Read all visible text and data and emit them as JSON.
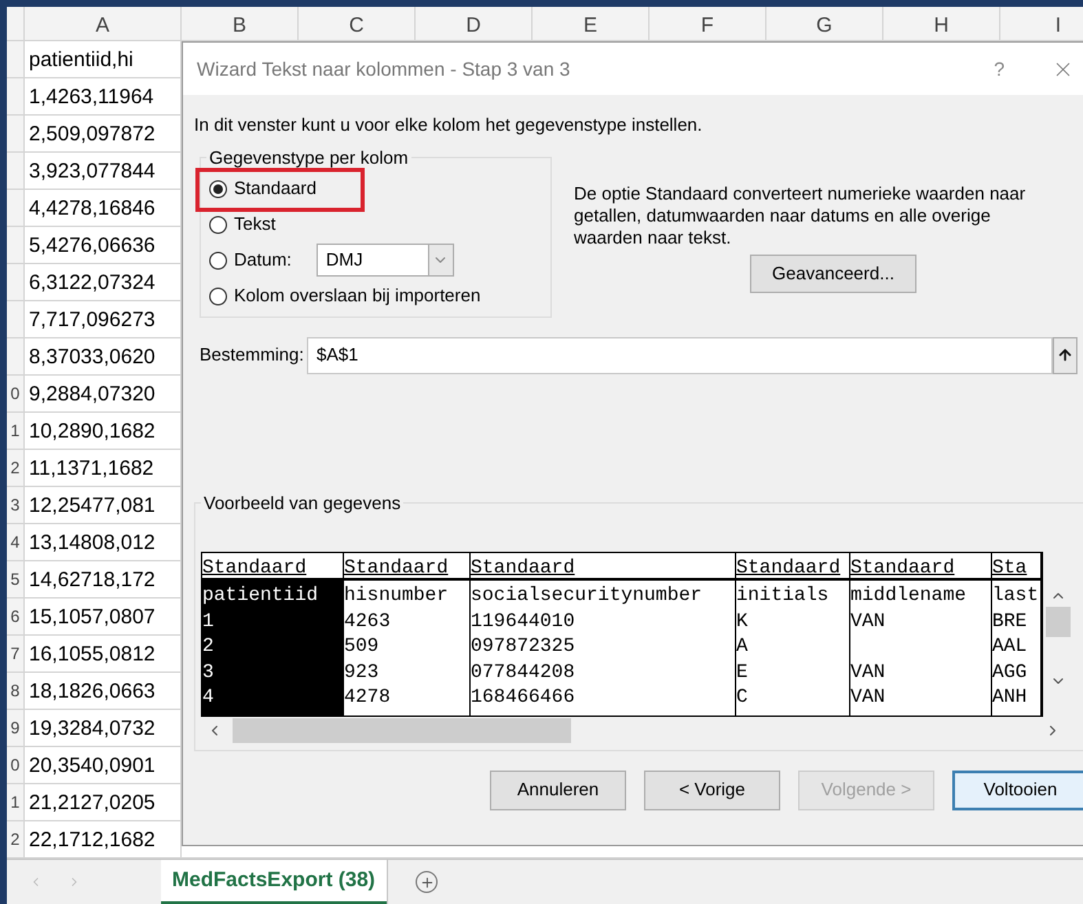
{
  "spreadsheet": {
    "column_headers": [
      "A",
      "B",
      "C",
      "D",
      "E",
      "F",
      "G",
      "H",
      "I"
    ],
    "rows": [
      {
        "row_number": "",
        "cell": "patientiid,hi"
      },
      {
        "row_number": "",
        "cell": "1,4263,11964"
      },
      {
        "row_number": "",
        "cell": "2,509,097872"
      },
      {
        "row_number": "",
        "cell": "3,923,077844"
      },
      {
        "row_number": "",
        "cell": "4,4278,16846"
      },
      {
        "row_number": "",
        "cell": "5,4276,06636"
      },
      {
        "row_number": "",
        "cell": "6,3122,07324"
      },
      {
        "row_number": "",
        "cell": "7,717,096273"
      },
      {
        "row_number": "",
        "cell": "8,37033,0620"
      },
      {
        "row_number": "0",
        "cell": "9,2884,07320"
      },
      {
        "row_number": "1",
        "cell": "10,2890,1682"
      },
      {
        "row_number": "2",
        "cell": "11,1371,1682"
      },
      {
        "row_number": "3",
        "cell": "12,25477,081"
      },
      {
        "row_number": "4",
        "cell": "13,14808,012"
      },
      {
        "row_number": "5",
        "cell": "14,62718,172"
      },
      {
        "row_number": "6",
        "cell": "15,1057,0807"
      },
      {
        "row_number": "7",
        "cell": "16,1055,0812"
      },
      {
        "row_number": "8",
        "cell": "18,1826,0663"
      },
      {
        "row_number": "9",
        "cell": "19,3284,0732"
      },
      {
        "row_number": "0",
        "cell": "20,3540,0901"
      },
      {
        "row_number": "1",
        "cell": "21,2127,0205"
      },
      {
        "row_number": "2",
        "cell": "22,1712,1682"
      }
    ]
  },
  "sheet_tabs": [
    {
      "label": "MedFactsExport (38)",
      "selected": true
    }
  ],
  "dialog": {
    "title": "Wizard Tekst naar kolommen - Stap 3 van 3",
    "help_button": "?",
    "intro": "In dit venster kunt u voor elke kolom het gegevenstype instellen.",
    "data_type_group": {
      "title": "Gegevenstype per kolom",
      "options": [
        {
          "label": "Standaard",
          "selected": true,
          "highlighted": true
        },
        {
          "label": "Tekst",
          "selected": false,
          "highlighted": false
        },
        {
          "label": "Datum:",
          "selected": false,
          "highlighted": false,
          "select_value": "DMJ"
        },
        {
          "label": "Kolom overslaan bij importeren",
          "selected": false,
          "highlighted": false
        }
      ]
    },
    "description": "De optie Standaard converteert numerieke waarden naar getallen, datumwaarden naar datums en alle overige waarden naar tekst.",
    "advanced_button": "Geavanceerd...",
    "destination": {
      "label": "Bestemming:",
      "value": "$A$1"
    },
    "preview": {
      "title": "Voorbeeld van gegevens",
      "columns": [
        {
          "type": "Standaard",
          "selected": true,
          "cells": [
            "patientiid",
            "1",
            "2",
            "3",
            "4"
          ]
        },
        {
          "type": "Standaard",
          "selected": false,
          "cells": [
            "hisnumber",
            "4263",
            "509",
            "923",
            "4278"
          ]
        },
        {
          "type": "Standaard",
          "selected": false,
          "cells": [
            "socialsecuritynumber",
            "119644010",
            "097872325",
            "077844208",
            "168466466"
          ]
        },
        {
          "type": "Standaard",
          "selected": false,
          "cells": [
            "initials",
            "K",
            "A",
            "E",
            "C"
          ]
        },
        {
          "type": "Standaard",
          "selected": false,
          "cells": [
            "middlename",
            "VAN",
            "",
            "VAN",
            "VAN"
          ]
        },
        {
          "type": "Sta",
          "selected": false,
          "cells": [
            "last",
            "BRE",
            "AAL",
            "AGG",
            "ANH"
          ]
        }
      ]
    },
    "buttons": [
      {
        "label": "Annuleren",
        "kind": "normal"
      },
      {
        "label": "< Vorige",
        "kind": "normal"
      },
      {
        "label": "Volgende >",
        "kind": "disabled"
      },
      {
        "label": "Voltooien",
        "kind": "default"
      }
    ]
  }
}
